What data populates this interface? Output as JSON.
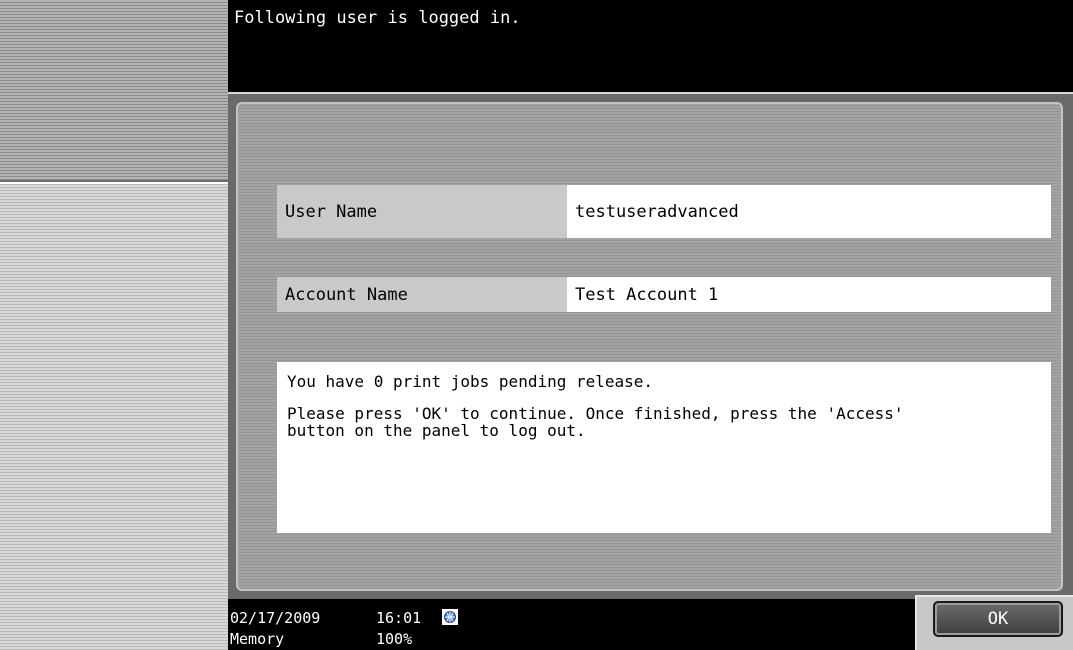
{
  "header": {
    "message": "Following user is logged in."
  },
  "fields": {
    "user_name": {
      "label": "User Name",
      "value": "testuseradvanced"
    },
    "account_name": {
      "label": "Account Name",
      "value": "Test Account 1"
    }
  },
  "message": {
    "line1": "You have 0 print jobs pending release.",
    "line2": "Please press 'OK' to continue. Once finished, press the 'Access'",
    "line3": "button on the panel to log out."
  },
  "status": {
    "date": "02/17/2009",
    "time": "16:01",
    "memory_label": "Memory",
    "memory_value": "100%",
    "network_icon": "network-icon"
  },
  "buttons": {
    "ok_label": "OK"
  },
  "colors": {
    "background": "#000000",
    "panel_gray": "#9a9a9a",
    "label_gray": "#c9c9c9",
    "text_white": "#ffffff"
  }
}
